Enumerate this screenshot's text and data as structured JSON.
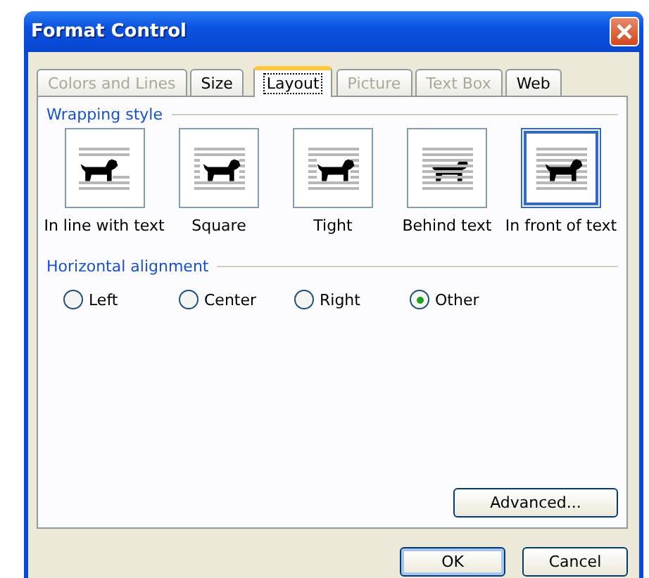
{
  "window": {
    "title": "Format Control"
  },
  "tabs": [
    {
      "label": "Colors and Lines",
      "selected": false,
      "disabled": true
    },
    {
      "label": "Size",
      "selected": false,
      "disabled": false
    },
    {
      "label": "Layout",
      "selected": true,
      "disabled": false
    },
    {
      "label": "Picture",
      "selected": false,
      "disabled": true
    },
    {
      "label": "Text Box",
      "selected": false,
      "disabled": true
    },
    {
      "label": "Web",
      "selected": false,
      "disabled": false
    }
  ],
  "wrapping_style": {
    "title": "Wrapping style",
    "options": [
      {
        "label": "In line with text",
        "kind": "inline",
        "selected": false
      },
      {
        "label": "Square",
        "kind": "square",
        "selected": false
      },
      {
        "label": "Tight",
        "kind": "tight",
        "selected": false
      },
      {
        "label": "Behind text",
        "kind": "behind",
        "selected": false
      },
      {
        "label": "In front of text",
        "kind": "front",
        "selected": true
      }
    ]
  },
  "horizontal_alignment": {
    "title": "Horizontal alignment",
    "options": [
      {
        "label": "Left",
        "selected": false
      },
      {
        "label": "Center",
        "selected": false
      },
      {
        "label": "Right",
        "selected": false
      },
      {
        "label": "Other",
        "selected": true
      }
    ]
  },
  "advanced_button": "Advanced...",
  "buttons": [
    "OK",
    "Cancel"
  ]
}
